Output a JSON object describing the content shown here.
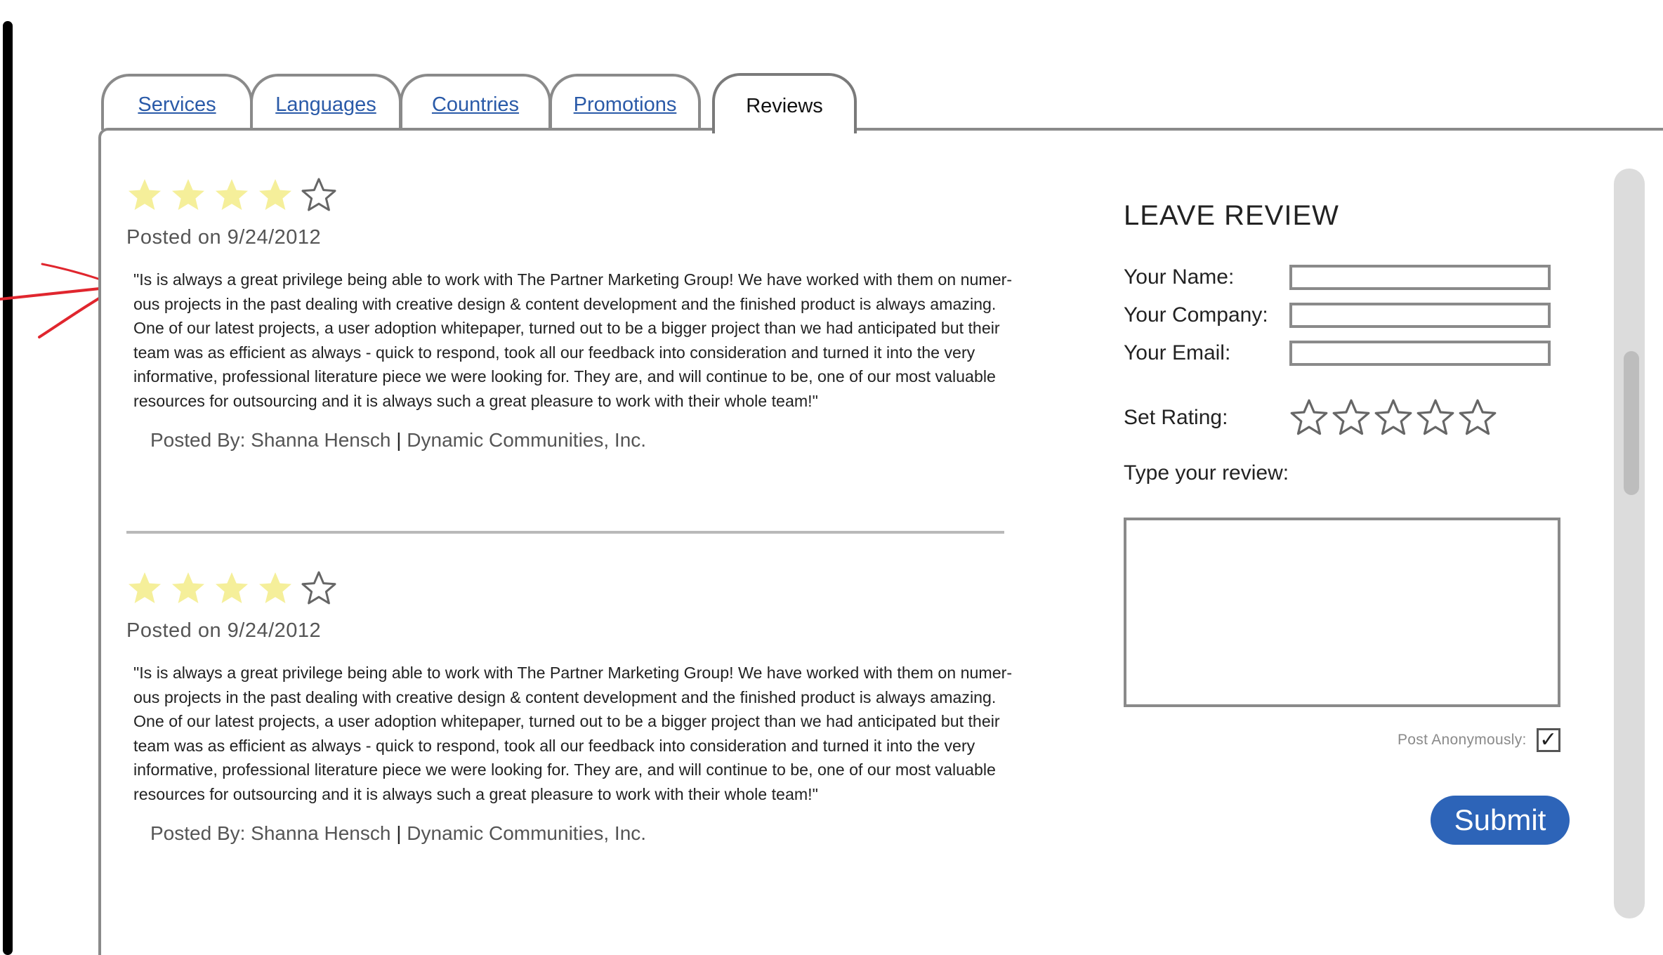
{
  "tabs": [
    {
      "label": "Services",
      "active": false
    },
    {
      "label": "Languages",
      "active": false
    },
    {
      "label": "Countries",
      "active": false
    },
    {
      "label": "Promotions",
      "active": false
    },
    {
      "label": "Reviews",
      "active": true
    }
  ],
  "reviews": [
    {
      "rating": 4,
      "rating_max": 5,
      "posted_date": "Posted on 9/24/2012",
      "body": "\"Is is always a great privilege being able to work with The Partner Marketing Group! We have worked with them on numer-ous projects in the past dealing with creative design & content development and the finished product is always amazing. One of our latest projects, a user adoption whitepaper, turned out to be a bigger project than we had anticipated but their team was as efficient as always - quick to respond, took all our feedback into consideration and turned it into the very informative, professional literature piece we were looking for. They are, and will continue to be, one of our most valuable resources for outsourcing and it is always such a great pleasure to work with their whole team!\"",
      "posted_by": "Posted By: Shanna Hensch",
      "separator": "|",
      "company": "Dynamic Communities, Inc."
    },
    {
      "rating": 4,
      "rating_max": 5,
      "posted_date": "Posted on 9/24/2012",
      "body": "\"Is is always a great privilege being able to work with The Partner Marketing Group! We have worked with them on numer-ous projects in the past dealing with creative design & content development and the finished product is always amazing. One of our latest projects, a user adoption whitepaper, turned out to be a bigger project than we had anticipated but their team was as efficient as always - quick to respond, took all our feedback into consideration and turned it into the very informative, professional literature piece we were looking for. They are, and will continue to be, one of our most valuable resources for outsourcing and it is always such a great pleasure to work with their whole team!\"",
      "posted_by": "Posted By: Shanna Hensch",
      "separator": "|",
      "company": "Dynamic Communities, Inc."
    }
  ],
  "form": {
    "title": "LEAVE REVIEW",
    "name_label": "Your Name:",
    "name_value": "",
    "company_label": "Your Company:",
    "company_value": "",
    "email_label": "Your Email:",
    "email_value": "",
    "rating_label": "Set Rating:",
    "rating_value": 0,
    "review_label": "Type your review:",
    "review_value": "",
    "anonymous_label": "Post Anonymously:",
    "anonymous_checked": true,
    "anonymous_mark": "✓",
    "submit_label": "Submit"
  },
  "colors": {
    "link": "#2a5aa8",
    "star_filled": "#f5ef9a",
    "star_outline": "#666666",
    "submit_bg": "#2d64b8",
    "annotation": "#e0262e"
  }
}
